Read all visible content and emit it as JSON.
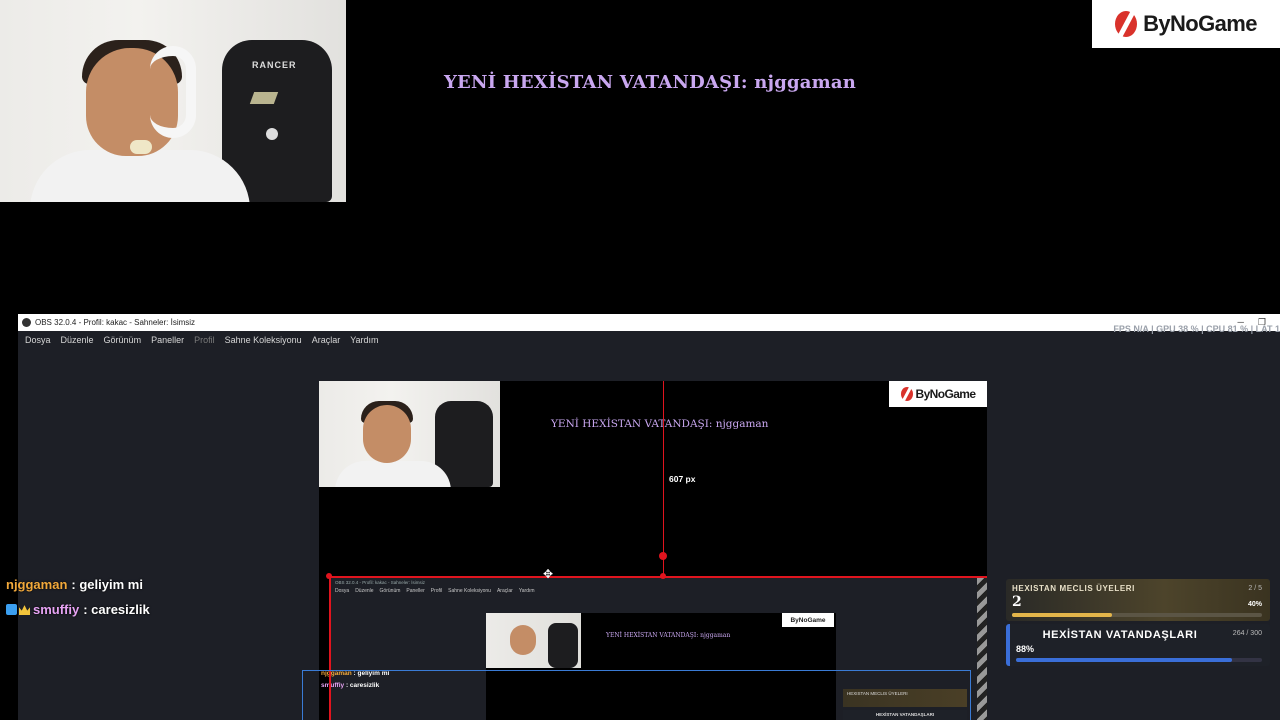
{
  "overlay": {
    "follower_alert": "YENİ HEXİSTAN VATANDAŞI: njggaman",
    "logo": "ByNoGame"
  },
  "obs": {
    "window_title": "OBS 32.0.4 - Profil: kakac - Sahneler: İsimsiz",
    "menu": [
      "Dosya",
      "Düzenle",
      "Görünüm",
      "Paneller",
      "Profil",
      "Sahne Koleksiyonu",
      "Araçlar",
      "Yardım"
    ],
    "stats": "FPS N/A  |  GPU 38 %  |  CPU 81 %  |  LAT 1",
    "guide_label": "607 px",
    "nested_title": "OBS 32.0.4 - Profil: kakac - Sahneler: İsimsiz",
    "nested_menu": [
      "Dosya",
      "Düzenle",
      "Görünüm",
      "Paneller",
      "Profil",
      "Sahne Koleksiyonu",
      "Araçlar",
      "Yardım"
    ],
    "nested_logo": "ByNoGame",
    "nested_alert": "YENİ HEXİSTAN VATANDAŞI: njggaman",
    "nested_card1": "HEXISTAN MECLIS ÜYELERI",
    "nested_card2": "HEXİSTAN VATANDAŞLARI",
    "nested_chat": [
      {
        "user": "njggaman",
        "msg": ": geliyim mi"
      },
      {
        "user": "smuffiy",
        "msg": ": caresizlik"
      }
    ]
  },
  "chat": [
    {
      "user": "njggaman",
      "msg": ": geliyim mi",
      "badges": []
    },
    {
      "user": "smuffiy",
      "msg": ": caresizlik",
      "badges": [
        "prime-icon",
        "crown-icon"
      ]
    }
  ],
  "panels": {
    "council": {
      "title": "HEXISTAN MECLIS ÜYELERI",
      "count": "2 / 5",
      "value": "2",
      "percent_label": "40%",
      "fill": 0.4
    },
    "citizens": {
      "title": "HEXİSTAN VATANDAŞLARI",
      "count": "264 / 300",
      "percent_label": "88%",
      "fill": 0.88
    }
  },
  "colors": {
    "accent_red": "#e0141e",
    "alert_purple": "#c9a7f0",
    "gold": "#e3b54a",
    "blue": "#3a6ed8"
  }
}
